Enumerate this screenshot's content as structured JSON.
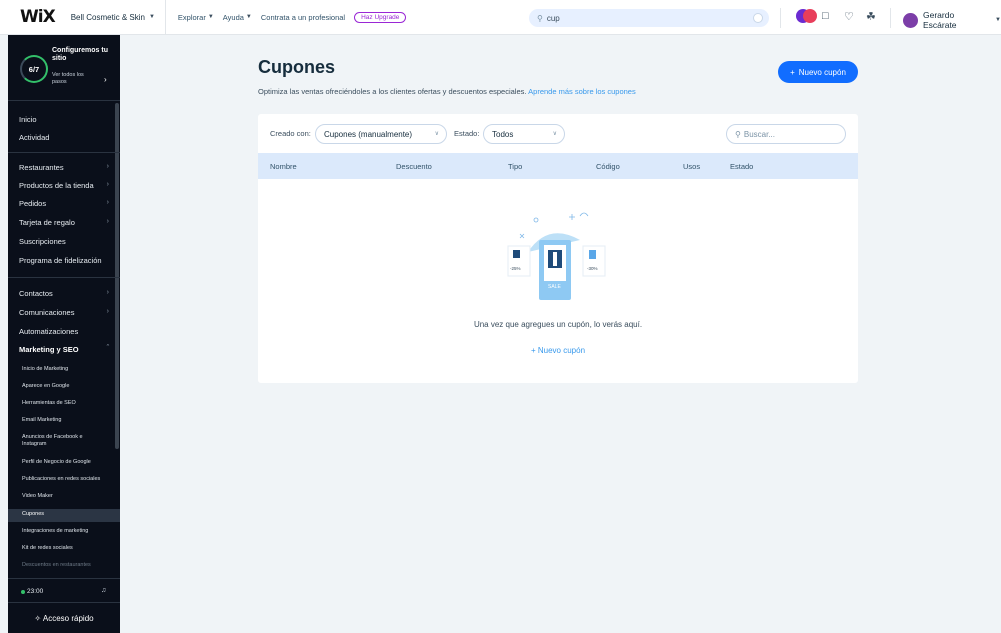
{
  "topbar": {
    "logo": "WiX",
    "site_name": "Bell Cosmetic & Skin",
    "menu": [
      "Explorar",
      "Ayuda",
      "Contrata a un profesional"
    ],
    "upgrade_label": "Haz Upgrade",
    "search_value": "cup",
    "user_name": "Gerardo Escárate"
  },
  "sidebar": {
    "setup_progress": "6/7",
    "setup_title": "Configuremos tu sitio",
    "setup_sub": "Ver todos los pasos",
    "nav": [
      {
        "label": "Inicio"
      },
      {
        "label": "Actividad"
      },
      {
        "label": "Restaurantes"
      },
      {
        "label": "Productos de la tienda"
      },
      {
        "label": "Pedidos"
      },
      {
        "label": "Tarjeta de regalo"
      },
      {
        "label": "Suscripciones"
      },
      {
        "label": "Programa de fidelización"
      },
      {
        "label": "Contactos"
      },
      {
        "label": "Comunicaciones"
      },
      {
        "label": "Automatizaciones"
      },
      {
        "label": "Marketing y SEO"
      }
    ],
    "sub": [
      "Inicio de Marketing",
      "Aparece en Google",
      "Herramientas de SEO",
      "Email Marketing",
      "Anuncios de Facebook e Instagram",
      "Perfil de Negocio de Google",
      "Publicaciones en redes sociales",
      "Video Maker",
      "Cupones",
      "Integraciones de marketing",
      "Kit de redes sociales",
      "Descuentos en restaurantes"
    ],
    "time": "23:00",
    "quick_access": "Acceso rápido"
  },
  "main": {
    "title": "Cupones",
    "description": "Optimiza las ventas ofreciéndoles a los clientes ofertas y descuentos especiales.",
    "learn_more": "Aprende más sobre los cupones",
    "new_button": "Nuevo cupón",
    "filters": {
      "created_label": "Creado con:",
      "created_value": "Cupones (manualmente)",
      "status_label": "Estado:",
      "status_value": "Todos",
      "search_placeholder": "Buscar..."
    },
    "columns": [
      "Nombre",
      "Descuento",
      "Tipo",
      "Código",
      "Usos",
      "Estado"
    ],
    "illustration": {
      "left": "-25%",
      "center": "SALE",
      "right": "-30%"
    },
    "empty_text": "Una vez que agregues un cupón, lo verás aquí.",
    "empty_link": "Nuevo cupón"
  },
  "colors": {
    "accent": "#116dff",
    "link": "#3899ec",
    "sidebar_bg": "#0a0f1a",
    "header_row": "#dbe9fb"
  }
}
